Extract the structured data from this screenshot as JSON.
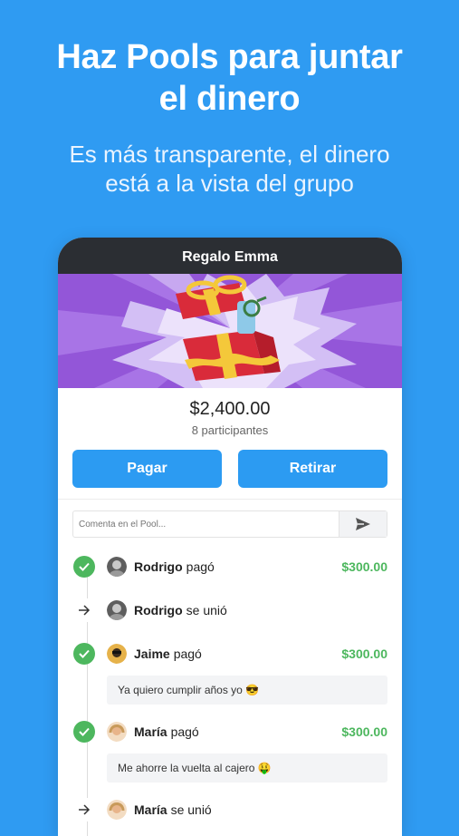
{
  "hero": {
    "title_line1": "Haz Pools para juntar",
    "title_line2": "el dinero",
    "subtitle_line1": "Es más transparente, el dinero",
    "subtitle_line2": "está a la vista del grupo"
  },
  "pool": {
    "title": "Regalo Emma",
    "amount": "$2,400.00",
    "participants": "8 participantes",
    "pay_label": "Pagar",
    "withdraw_label": "Retirar",
    "comment_placeholder": "Comenta en el Pool..."
  },
  "feed": [
    {
      "type": "paid",
      "name": "Rodrigo",
      "verb": "pagó",
      "amount": "$300.00"
    },
    {
      "type": "joined",
      "name": "Rodrigo",
      "verb": "se unió"
    },
    {
      "type": "paid",
      "name": "Jaime",
      "verb": "pagó",
      "amount": "$300.00",
      "comment": "Ya quiero cumplir años yo 😎"
    },
    {
      "type": "paid",
      "name": "María",
      "verb": "pagó",
      "amount": "$300.00",
      "comment": "Me ahorre la vuelta al cajero 🤑"
    },
    {
      "type": "joined",
      "name": "María",
      "verb": "se unió"
    }
  ],
  "colors": {
    "background": "#2f9bf2",
    "accent": "#2c9bf2",
    "success": "#4db75e",
    "banner": "#9356d8",
    "titlebar": "#2b2e33"
  },
  "icons": [
    "gift-box-illustration",
    "send-icon",
    "check-icon",
    "arrow-right-icon"
  ]
}
